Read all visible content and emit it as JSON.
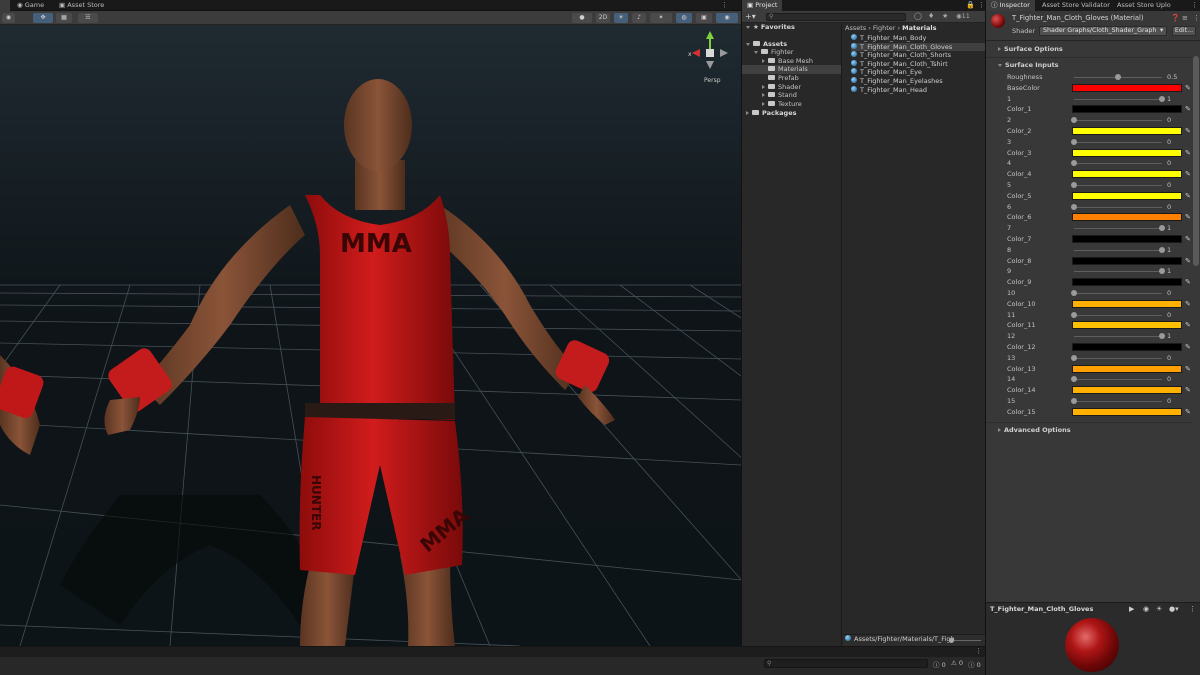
{
  "editor_tabs": [
    {
      "label": "Game",
      "icon": "gamepad-icon"
    },
    {
      "label": "Asset Store",
      "icon": "store-icon"
    }
  ],
  "scene_toolbar": {
    "mode_2d": "2D",
    "gizmo_persp_label": "Persp",
    "gizmo_axis_x": "x"
  },
  "scene": {
    "shirt_print": "MMA",
    "shorts_print": "MMA",
    "shorts_side_print": "HUNTER"
  },
  "project": {
    "tab_label": "Project",
    "visible_count": "11",
    "favorites_label": "Favorites",
    "tree": [
      {
        "label": "Assets",
        "bold": true
      },
      {
        "label": "Fighter"
      },
      {
        "label": "Base Mesh"
      },
      {
        "label": "Materials"
      },
      {
        "label": "Prefab"
      },
      {
        "label": "Shader"
      },
      {
        "label": "Stand"
      },
      {
        "label": "Texture"
      },
      {
        "label": "Packages",
        "bold": true
      }
    ],
    "breadcrumb": [
      "Assets",
      "Fighter",
      "Materials"
    ],
    "files": [
      "T_Fighter_Man_Body",
      "T_Fighter_Man_Cloth_Gloves",
      "T_Fighter_Man_Cloth_Shorts",
      "T_Fighter_Man_Cloth_Tshirt",
      "T_Fighter_Man_Eye",
      "T_Fighter_Man_Eyelashes",
      "T_Fighter_Man_Head"
    ],
    "selected_index": 1,
    "status_path": "Assets/Fighter/Materials/T_Figh"
  },
  "bottom": {
    "error_count": "0",
    "warning_count": "0",
    "log_count": "0"
  },
  "inspector": {
    "tabs": [
      "Inspector",
      "Asset Store Validator",
      "Asset Store Uplo"
    ],
    "material_name": "T_Fighter_Man_Cloth_Gloves (Material)",
    "shader_label": "Shader",
    "shader_value": "Shader Graphs/Cloth_Shader_Graph",
    "edit_label": "Edit...",
    "section_surface_options": "Surface Options",
    "section_surface_inputs": "Surface Inputs",
    "section_advanced": "Advanced Options",
    "properties": [
      {
        "label": "Roughness",
        "type": "slider",
        "value": "0.5",
        "level": 0.5
      },
      {
        "label": "BaseColor",
        "type": "color",
        "color": "#ff0000"
      },
      {
        "label": "1",
        "type": "slider",
        "value": "1",
        "level": 1
      },
      {
        "label": "Color_1",
        "type": "color",
        "color": "#000000"
      },
      {
        "label": "2",
        "type": "slider",
        "value": "0",
        "level": 0
      },
      {
        "label": "Color_2",
        "type": "color",
        "color": "#ffff00"
      },
      {
        "label": "3",
        "type": "slider",
        "value": "0",
        "level": 0
      },
      {
        "label": "Color_3",
        "type": "color",
        "color": "#ffff00"
      },
      {
        "label": "4",
        "type": "slider",
        "value": "0",
        "level": 0
      },
      {
        "label": "Color_4",
        "type": "color",
        "color": "#ffff00"
      },
      {
        "label": "5",
        "type": "slider",
        "value": "0",
        "level": 0
      },
      {
        "label": "Color_5",
        "type": "color",
        "color": "#ffff00"
      },
      {
        "label": "6",
        "type": "slider",
        "value": "0",
        "level": 0
      },
      {
        "label": "Color_6",
        "type": "color",
        "color": "#ff8000"
      },
      {
        "label": "7",
        "type": "slider",
        "value": "1",
        "level": 1
      },
      {
        "label": "Color_7",
        "type": "color",
        "color": "#000000"
      },
      {
        "label": "8",
        "type": "slider",
        "value": "1",
        "level": 1
      },
      {
        "label": "Color_8",
        "type": "color",
        "color": "#000000"
      },
      {
        "label": "9",
        "type": "slider",
        "value": "1",
        "level": 1
      },
      {
        "label": "Color_9",
        "type": "color",
        "color": "#000000"
      },
      {
        "label": "10",
        "type": "slider",
        "value": "0",
        "level": 0
      },
      {
        "label": "Color_10",
        "type": "color",
        "color": "#ffb000"
      },
      {
        "label": "11",
        "type": "slider",
        "value": "0",
        "level": 0
      },
      {
        "label": "Color_11",
        "type": "color",
        "color": "#ffc000"
      },
      {
        "label": "12",
        "type": "slider",
        "value": "1",
        "level": 1
      },
      {
        "label": "Color_12",
        "type": "color",
        "color": "#000000"
      },
      {
        "label": "13",
        "type": "slider",
        "value": "0",
        "level": 0
      },
      {
        "label": "Color_13",
        "type": "color",
        "color": "#ffa000"
      },
      {
        "label": "14",
        "type": "slider",
        "value": "0",
        "level": 0
      },
      {
        "label": "Color_14",
        "type": "color",
        "color": "#ffb000"
      },
      {
        "label": "15",
        "type": "slider",
        "value": "0",
        "level": 0
      },
      {
        "label": "Color_15",
        "type": "color",
        "color": "#ffb000"
      }
    ],
    "preview_title": "T_Fighter_Man_Cloth_Gloves"
  }
}
